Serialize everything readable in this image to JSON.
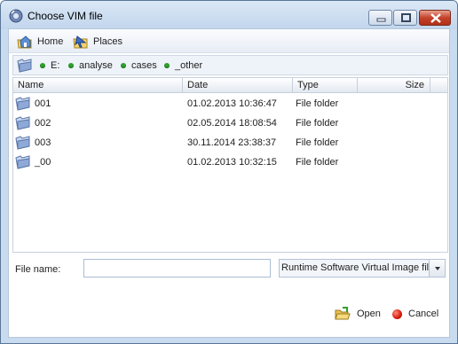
{
  "window": {
    "title": "Choose VIM file"
  },
  "toolbar": {
    "home_label": "Home",
    "places_label": "Places"
  },
  "path": {
    "segments": [
      "E:",
      "analyse",
      "cases",
      "_other"
    ]
  },
  "table": {
    "columns": [
      "Name",
      "Date",
      "Type",
      "Size"
    ],
    "rows": [
      {
        "name": "001",
        "date": "01.02.2013 10:36:47",
        "type": "File folder",
        "size": ""
      },
      {
        "name": "002",
        "date": "02.05.2014 18:08:54",
        "type": "File folder",
        "size": ""
      },
      {
        "name": "003",
        "date": "30.11.2014 23:38:37",
        "type": "File folder",
        "size": ""
      },
      {
        "name": "_00",
        "date": "01.02.2013 10:32:15",
        "type": "File folder",
        "size": ""
      }
    ]
  },
  "file_name": {
    "label": "File name:",
    "value": ""
  },
  "file_type": {
    "selected": "Runtime Software Virtual Image file"
  },
  "actions": {
    "open_label": "Open",
    "cancel_label": "Cancel"
  },
  "colors": {
    "accent": "#2f9f2f",
    "cancel": "#d51a0a",
    "close": "#c4422b"
  }
}
